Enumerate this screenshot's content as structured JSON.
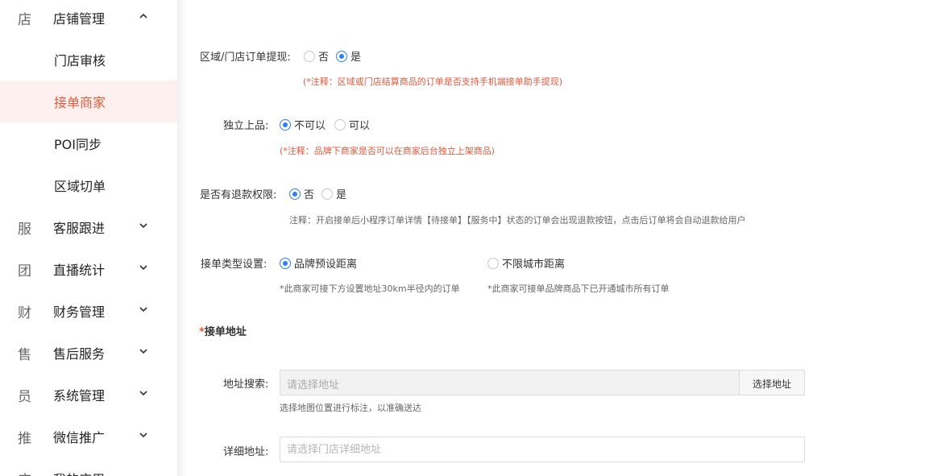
{
  "sidebar": {
    "store_group": {
      "icon_char": "店",
      "label": "店铺管理"
    },
    "store_items": [
      {
        "label": "门店审核"
      },
      {
        "label": "接单商家"
      },
      {
        "label": "POI同步"
      },
      {
        "label": "区域切单"
      }
    ],
    "groups": [
      {
        "icon_char": "服",
        "label": "客服跟进"
      },
      {
        "icon_char": "团",
        "label": "直播统计"
      },
      {
        "icon_char": "财",
        "label": "财务管理"
      },
      {
        "icon_char": "售",
        "label": "售后服务"
      },
      {
        "icon_char": "员",
        "label": "系统管理"
      },
      {
        "icon_char": "推",
        "label": "微信推广"
      },
      {
        "icon_char": "应",
        "label": "我的应用"
      }
    ]
  },
  "form": {
    "withdraw": {
      "label": "区域/门店订单提现:",
      "options": [
        "否",
        "是"
      ],
      "selected": "是",
      "note": "(*注释：区域或门店结算商品的订单是否支持手机端接单助手提现)"
    },
    "independent": {
      "label": "独立上品:",
      "options": [
        "不可以",
        "可以"
      ],
      "selected": "不可以",
      "note": "(*注释：品牌下商家是否可以在商家后台独立上架商品)"
    },
    "refund": {
      "label": "是否有退款权限:",
      "options": [
        "否",
        "是"
      ],
      "selected": "否",
      "note": "注释：开启接单后小程序订单详情【待接单】【服务中】状态的订单会出现退款按钮，点击后订单将会自动退款给用户"
    },
    "order_type": {
      "label": "接单类型设置:",
      "options": [
        "品牌预设距离",
        "不限城市距离"
      ],
      "selected": "品牌预设距离",
      "notes": [
        "*此商家可接下方设置地址30km半径内的订单",
        "*此商家可接单品牌商品下已开通城市所有订单"
      ]
    },
    "address_section": {
      "required_mark": "*",
      "title": "接单地址"
    },
    "address_search": {
      "label": "地址搜索:",
      "placeholder": "请选择地址",
      "button": "选择地址",
      "hint": "选择地图位置进行标注，以准确送达"
    },
    "detail_address": {
      "label": "详细地址:",
      "placeholder": "请选择门店详细地址",
      "value": ""
    }
  },
  "colors": {
    "accent": "#e4593e",
    "active_bg": "#fdf1ef",
    "radio": "#2f7ff5"
  }
}
